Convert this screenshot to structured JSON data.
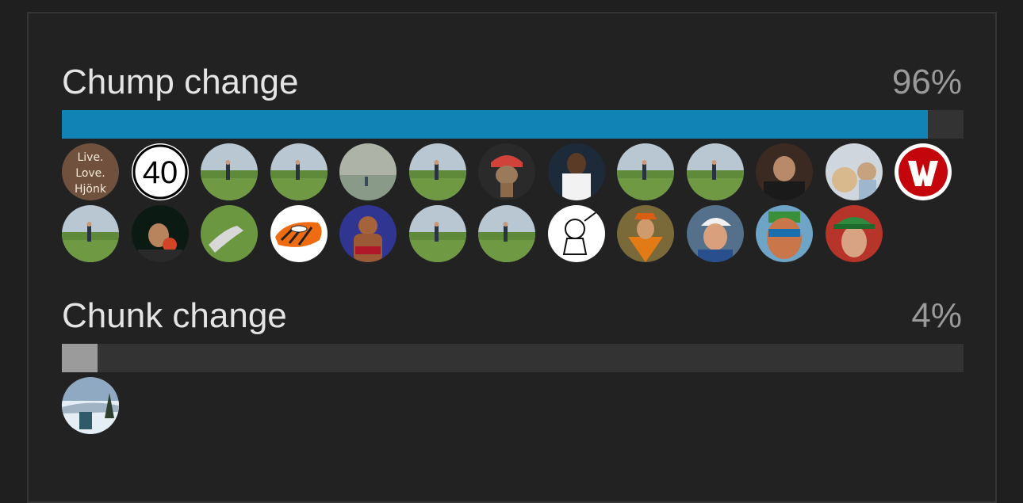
{
  "poll": {
    "options": [
      {
        "label": "Chump change",
        "percent_text": "96%",
        "percent": 0.96,
        "bar_color": "#1183b5",
        "voters": [
          {
            "kind": "sign",
            "text_lines": [
              "Live.",
              "Love.",
              "Hjönk"
            ]
          },
          {
            "kind": "number",
            "text": "40"
          },
          {
            "kind": "photo-golf"
          },
          {
            "kind": "photo-man-field"
          },
          {
            "kind": "photo-coast"
          },
          {
            "kind": "photo-golf-green"
          },
          {
            "kind": "photo-toy"
          },
          {
            "kind": "photo-athlete"
          },
          {
            "kind": "photo-golf-house"
          },
          {
            "kind": "photo-golf-trees"
          },
          {
            "kind": "photo-man-dark"
          },
          {
            "kind": "photo-dog"
          },
          {
            "kind": "logo-w"
          },
          {
            "kind": "photo-fairway"
          },
          {
            "kind": "photo-man-night"
          },
          {
            "kind": "photo-club"
          },
          {
            "kind": "drawing-hat"
          },
          {
            "kind": "photo-wrestler"
          },
          {
            "kind": "photo-golfer-grass"
          },
          {
            "kind": "photo-sea-golfer"
          },
          {
            "kind": "drawing-cartoon"
          },
          {
            "kind": "photo-argyle"
          },
          {
            "kind": "photo-man-cap"
          },
          {
            "kind": "photo-mask"
          },
          {
            "kind": "photo-elf"
          }
        ]
      },
      {
        "label": "Chunk change",
        "percent_text": "4%",
        "percent": 0.04,
        "bar_color": "#9b9b9b",
        "voters": [
          {
            "kind": "photo-snow"
          }
        ]
      }
    ]
  }
}
